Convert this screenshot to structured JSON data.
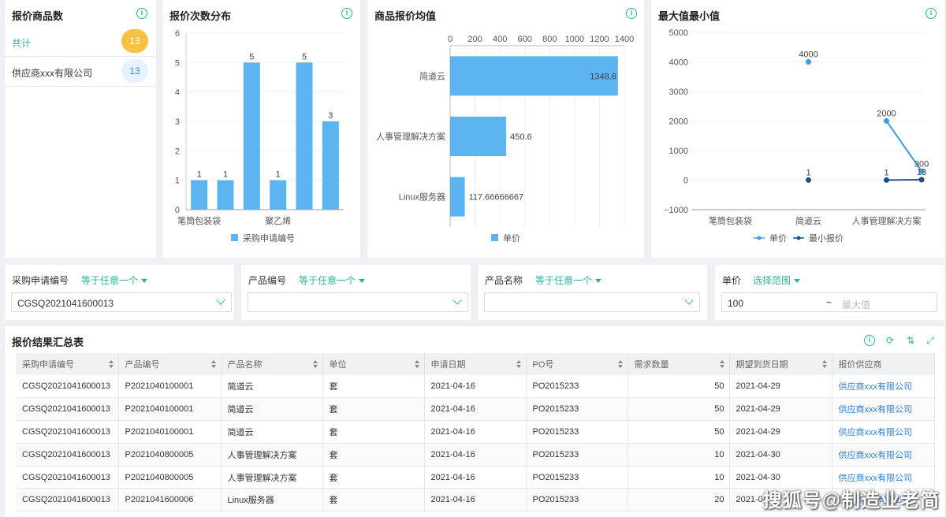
{
  "count_card": {
    "title": "报价商品数",
    "rows": [
      {
        "label": "共计",
        "value": "13"
      },
      {
        "label": "供应商xxx有限公司",
        "value": "13"
      }
    ]
  },
  "freq_chart": {
    "title": "报价次数分布",
    "chart_data": {
      "type": "bar",
      "categories": [
        "笔筒包装袋",
        "",
        "",
        "聚乙烯",
        "",
        ""
      ],
      "series": [
        {
          "name": "采购申请编号",
          "values": [
            1,
            1,
            5,
            1,
            5,
            3
          ]
        }
      ],
      "ylim": [
        0,
        6
      ],
      "yticks": [
        "0",
        "1",
        "2",
        "3",
        "4",
        "5",
        "6"
      ],
      "legend": "bottom",
      "color": "#5bb4f0"
    }
  },
  "avg_chart": {
    "title": "商品报价均值",
    "chart_data": {
      "type": "bar",
      "orientation": "horizontal",
      "categories": [
        "简道云",
        "人事管理解决方案",
        "Linux服务器"
      ],
      "series": [
        {
          "name": "单价",
          "values": [
            1348.6,
            450.6,
            117.66666667
          ],
          "labels": [
            "1348.6",
            "450.6",
            "117.66666667"
          ]
        }
      ],
      "xlim": [
        0,
        1400
      ],
      "xticks": [
        "0",
        "200",
        "400",
        "600",
        "800",
        "1000",
        "1200",
        "1400"
      ],
      "legend": "bottom",
      "color": "#5bb4f0"
    }
  },
  "maxmin_chart": {
    "title": "最大值最小值",
    "chart_data": {
      "type": "line",
      "categories": [
        "笔筒包装袋",
        "简道云",
        "人事管理解决方案"
      ],
      "x_points": [
        {
          "name": "单价",
          "color": "#3a9de0",
          "points": [
            [
              1,
              4000,
              "4000"
            ],
            [
              2,
              2000,
              "2000"
            ],
            [
              2.45,
              300,
              "300"
            ]
          ],
          "connect": [
            1,
            2
          ]
        },
        {
          "name": "最小报价",
          "color": "#1a4f8a",
          "points": [
            [
              1,
              1,
              "1"
            ],
            [
              2,
              1,
              "1"
            ],
            [
              2.45,
              13,
              "13"
            ]
          ],
          "connect": [
            1,
            2
          ]
        }
      ],
      "ylim": [
        -1000,
        5000
      ],
      "yticks": [
        "−1000",
        "0",
        "1000",
        "2000",
        "3000",
        "4000",
        "5000"
      ],
      "legend": "bottom"
    }
  },
  "filters": [
    {
      "label": "采购申请编号",
      "op": "等于任意一个",
      "value": "CGSQ2021041600013"
    },
    {
      "label": "产品编号",
      "op": "等于任意一个",
      "value": ""
    },
    {
      "label": "产品名称",
      "op": "等于任意一个",
      "value": ""
    },
    {
      "label": "单价",
      "op": "选择范围",
      "min": "100",
      "sep": "~",
      "max_placeholder": "最大值"
    }
  ],
  "table": {
    "title": "报价结果汇总表",
    "columns": [
      "采购申请编号",
      "产品编号",
      "产品名称",
      "单位",
      "申请日期",
      "PO号",
      "需求数量",
      "期望到货日期",
      "报价供应商"
    ],
    "rows": [
      [
        "CGSQ2021041600013",
        "P2021040100001",
        "简道云",
        "套",
        "2021-04-16",
        "PO2015233",
        "50",
        "2021-04-29",
        "供应商xxx有限公司"
      ],
      [
        "CGSQ2021041600013",
        "P2021040100001",
        "简道云",
        "套",
        "2021-04-16",
        "PO2015233",
        "50",
        "2021-04-29",
        "供应商xxx有限公司"
      ],
      [
        "CGSQ2021041600013",
        "P2021040100001",
        "简道云",
        "套",
        "2021-04-16",
        "PO2015233",
        "50",
        "2021-04-29",
        "供应商xxx有限公司"
      ],
      [
        "CGSQ2021041600013",
        "P2021040800005",
        "人事管理解决方案",
        "套",
        "2021-04-16",
        "PO2015233",
        "10",
        "2021-04-30",
        "供应商xxx有限公司"
      ],
      [
        "CGSQ2021041600013",
        "P2021040800005",
        "人事管理解决方案",
        "套",
        "2021-04-16",
        "PO2015233",
        "10",
        "2021-04-30",
        "供应商xxx有限公司"
      ],
      [
        "CGSQ2021041600013",
        "P2021041600006",
        "Linux服务器",
        "套",
        "2021-04-16",
        "PO2015233",
        "20",
        "2021-04-30",
        "供应商xxx有限公司"
      ]
    ]
  },
  "watermark": "搜狐号@制造业老简"
}
